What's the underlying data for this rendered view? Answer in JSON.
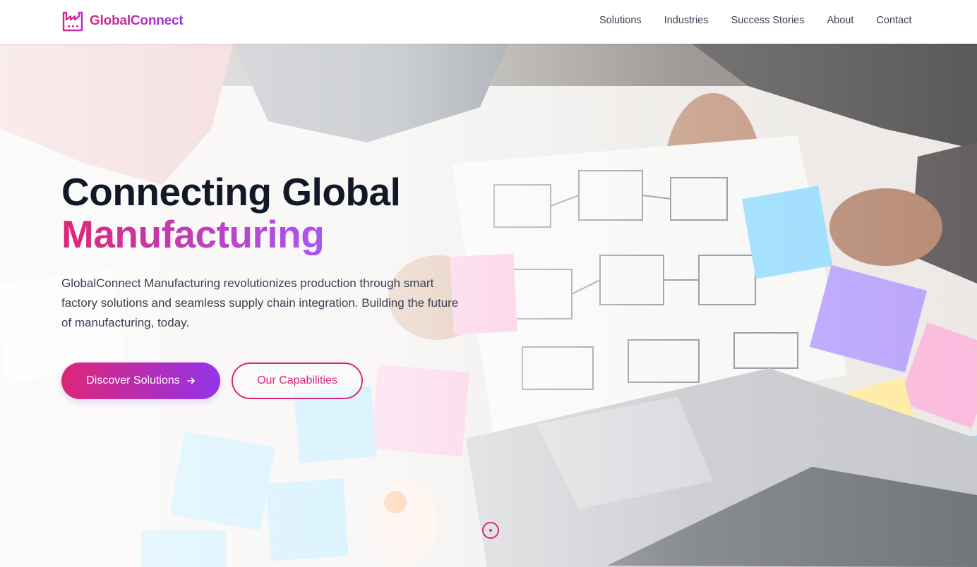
{
  "brand": {
    "name": "GlobalConnect",
    "icon": "factory-icon"
  },
  "nav": {
    "items": [
      "Solutions",
      "Industries",
      "Success Stories",
      "About",
      "Contact"
    ]
  },
  "hero": {
    "title_line1": "Connecting Global",
    "title_line2": "Manufacturing",
    "description": "GlobalConnect Manufacturing revolutionizes production through smart factory solutions and seamless supply chain integration. Building the future of manufacturing, today.",
    "primary_button": {
      "label": "Discover Solutions",
      "icon": "arrow-right-icon"
    },
    "secondary_button": {
      "label": "Our Capabilities"
    },
    "scroll_indicator_icon": "scroll-down-icon"
  },
  "colors": {
    "accent_pink": "#db2777",
    "accent_purple": "#9333ea",
    "heading": "#111827",
    "body_text": "#374151"
  }
}
